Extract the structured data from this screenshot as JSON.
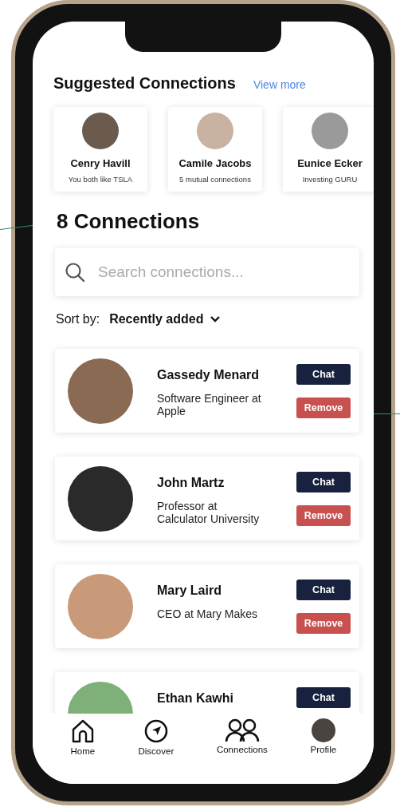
{
  "suggested": {
    "title": "Suggested Connections",
    "link": "View more",
    "people": [
      {
        "name": "Cenry Havill",
        "note": "You both like TSLA"
      },
      {
        "name": "Camile Jacobs",
        "note": "5 mutual connections"
      },
      {
        "name": "Eunice Ecker",
        "note": "Investing GURU"
      }
    ]
  },
  "count_title": "8 Connections",
  "search": {
    "placeholder": "Search connections..."
  },
  "sort": {
    "label": "Sort by:",
    "value": "Recently added"
  },
  "connections": [
    {
      "name": "Gassedy Menard",
      "title": "Software Engineer at Apple",
      "buttons": [
        {
          "kind": "chat",
          "label": "Chat"
        },
        {
          "kind": "remove",
          "label": "Remove"
        }
      ]
    },
    {
      "name": "John Martz",
      "title": "Professor at Calculator University",
      "buttons": [
        {
          "kind": "chat",
          "label": "Chat"
        },
        {
          "kind": "remove",
          "label": "Remove"
        }
      ]
    },
    {
      "name": "Mary Laird",
      "title": "CEO at Mary Makes",
      "buttons": [
        {
          "kind": "chat",
          "label": "Chat"
        },
        {
          "kind": "remove",
          "label": "Remove"
        }
      ]
    },
    {
      "name": "Ethan Kawhi",
      "buttons": [
        {
          "kind": "chat",
          "label": "Chat"
        }
      ]
    }
  ],
  "nav": [
    {
      "kind": "home",
      "label": "Home"
    },
    {
      "kind": "discover",
      "label": "Discover"
    },
    {
      "kind": "connections",
      "label": "Connections"
    },
    {
      "kind": "profile",
      "label": "Profile"
    }
  ]
}
